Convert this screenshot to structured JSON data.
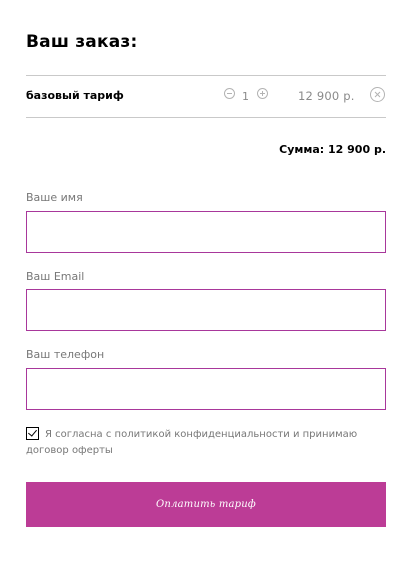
{
  "order": {
    "title": "Ваш заказ:",
    "item": {
      "name": "базовый тариф",
      "quantity": "1",
      "price": "12 900 р."
    },
    "total": "Сумма: 12 900 р."
  },
  "form": {
    "name_label": "Ваше имя",
    "name_value": "",
    "email_label": "Ваш Email",
    "email_value": "",
    "phone_label": "Ваш телефон",
    "phone_value": "",
    "agreement_text": "Я согласна с политикой конфиденциальности и принимаю договор оферты",
    "agreement_checked": true,
    "submit_label": "Оплатить тариф"
  },
  "colors": {
    "accent": "#bc3c96",
    "input_border": "#a8379b",
    "divider": "#c9c9c9",
    "muted_text": "#777777"
  },
  "icons": {
    "minus": "minus-circle-icon",
    "plus": "plus-circle-icon",
    "remove": "close-circle-icon",
    "checkbox": "checkmark-icon"
  }
}
